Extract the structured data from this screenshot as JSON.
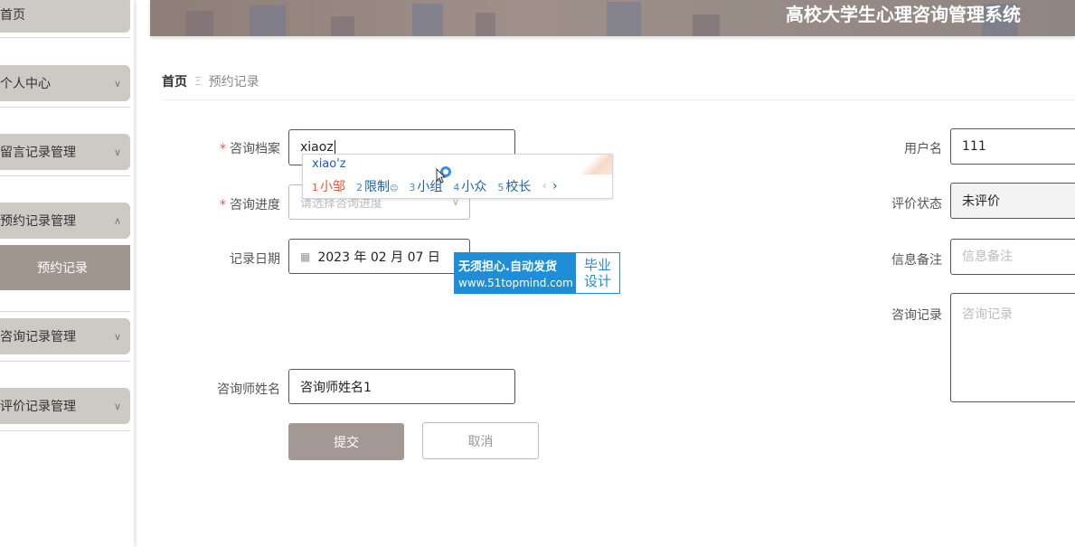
{
  "app": {
    "title": "高校大学生心理咨询管理系统"
  },
  "sidebar": {
    "items": [
      {
        "label": "首页"
      },
      {
        "label": "个人中心"
      },
      {
        "label": "留言记录管理"
      },
      {
        "label": "预约记录管理"
      },
      {
        "label": "预约记录"
      },
      {
        "label": "咨询记录管理"
      },
      {
        "label": "评价记录管理"
      }
    ]
  },
  "breadcrumb": {
    "home": "首页",
    "separator": "Ξ",
    "current": "预约记录"
  },
  "form": {
    "consult_file": {
      "label": "咨询档案",
      "value": "xiaoz"
    },
    "progress": {
      "label": "咨询进度",
      "placeholder": "请选择咨询进度"
    },
    "record_date": {
      "label": "记录日期",
      "value": "2023 年 02 月 07 日"
    },
    "counselor_name": {
      "label": "咨询师姓名",
      "value": "咨询师姓名1"
    },
    "username": {
      "label": "用户名",
      "value": "111"
    },
    "eval_status": {
      "label": "评价状态",
      "value": "未评价"
    },
    "remark": {
      "label": "信息备注",
      "placeholder": "信息备注"
    },
    "consult_record": {
      "label": "咨询记录",
      "placeholder": "咨询记录"
    },
    "submit_label": "提交",
    "cancel_label": "取消"
  },
  "ime": {
    "composition": "xiao'z",
    "candidates": [
      {
        "n": "1",
        "text": "小邹"
      },
      {
        "n": "2",
        "text": "限制"
      },
      {
        "n": "3",
        "text": "小组"
      },
      {
        "n": "4",
        "text": "小众"
      },
      {
        "n": "5",
        "text": "校长"
      }
    ],
    "prev": "‹",
    "next": "›"
  },
  "watermark": {
    "line1": "无须担心.自动发货",
    "line2": "www.51topmind.com",
    "right1": "毕业",
    "right2": "设计"
  },
  "colors": {
    "accent": "#a39893",
    "menu_bg": "#cdcac6",
    "active_sub": "#a0958f",
    "ime_blue": "#1e5fae",
    "ime_selected": "#e4572e",
    "watermark_blue": "#1e8fd6"
  }
}
